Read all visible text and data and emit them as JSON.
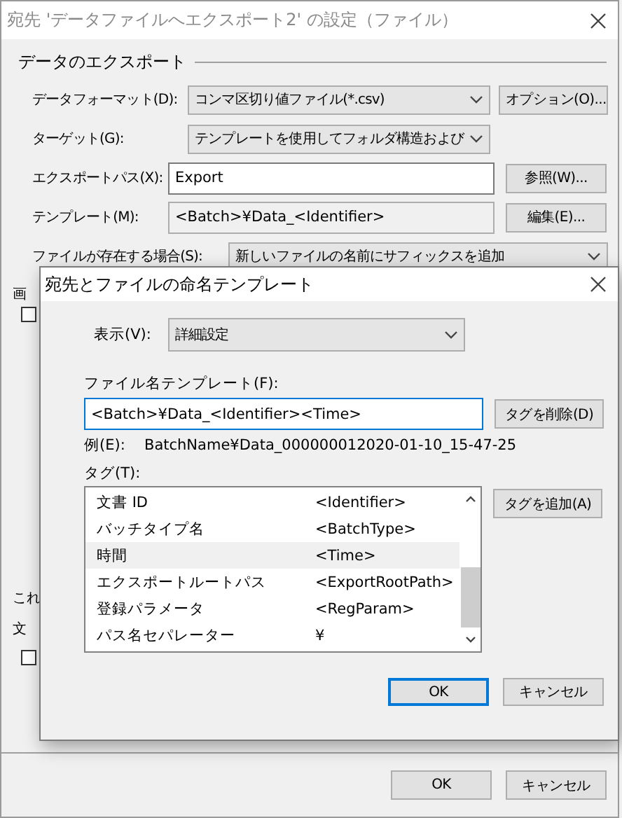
{
  "window": {
    "title": "宛先 'データファイルへエクスポート2' の設定（ファイル）"
  },
  "export_section": {
    "title": "データのエクスポート",
    "rows": [
      {
        "kind": "combo",
        "label": "データフォーマット(D):",
        "value": "コンマ区切り値ファイル(*.csv)",
        "button": "オプション(O)..."
      },
      {
        "kind": "combo",
        "label": "ターゲット(G):",
        "value": "テンプレートを使用してフォルダ構造および"
      },
      {
        "kind": "input",
        "label": "エクスポートパス(X):",
        "value": "Export",
        "button": "参照(W)..."
      },
      {
        "kind": "readonly",
        "label": "テンプレート(M):",
        "value": "<Batch>¥Data_<Identifier>",
        "button": "編集(E)..."
      },
      {
        "kind": "wide-combo",
        "label": "ファイルが存在する場合(S):",
        "value": "新しいファイルの名前にサフィックスを追加"
      }
    ]
  },
  "hidden_items": [
    {
      "kind": "text",
      "label": "画"
    },
    {
      "kind": "checkbox",
      "checked": false
    },
    {
      "kind": "text",
      "label": "これ"
    },
    {
      "kind": "text",
      "label": "文"
    },
    {
      "kind": "checkbox",
      "checked": false
    }
  ],
  "buttons": [
    "OK",
    "キャンセル"
  ],
  "template_dialog": {
    "title": "宛先とファイルの命名テンプレート",
    "view": {
      "label": "表示(V):",
      "value": "詳細設定"
    },
    "filename_template": {
      "label": "ファイル名テンプレート(F):",
      "value": "<Batch>¥Data_<Identifier><Time>",
      "button": "タグを削除(D)"
    },
    "example": {
      "label": "例(E):",
      "value": "BatchName¥Data_000000012020-01-10_15-47-25"
    },
    "tags": {
      "label": "タグ(T):",
      "button": "タグを追加(A)",
      "items": [
        {
          "name": "文書 ID",
          "tag": "<Identifier>",
          "selected": false
        },
        {
          "name": "バッチタイプ名",
          "tag": "<BatchType>",
          "selected": false
        },
        {
          "name": "時間",
          "tag": "<Time>",
          "selected": true
        },
        {
          "name": "エクスポートルートパス",
          "tag": "<ExportRootPath>",
          "selected": false
        },
        {
          "name": "登録パラメータ",
          "tag": "<RegParam>",
          "selected": false
        },
        {
          "name": "パス名セパレーター",
          "tag": "¥",
          "selected": false
        }
      ]
    },
    "buttons": [
      {
        "label": "OK",
        "default": true
      },
      {
        "label": "キャンセル",
        "default": false
      }
    ]
  }
}
